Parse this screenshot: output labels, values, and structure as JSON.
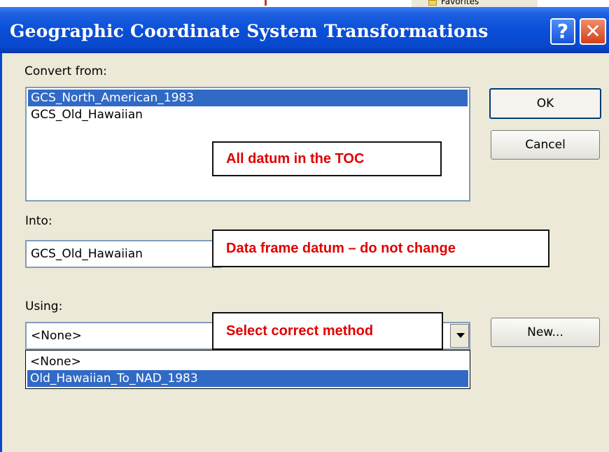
{
  "background_window": {
    "favorites_label": "Favorites"
  },
  "window": {
    "title": "Geographic Coordinate System Transformations",
    "help_glyph": "?",
    "close_glyph": "✕"
  },
  "convert_from": {
    "label": "Convert from:",
    "items": [
      {
        "text": "GCS_North_American_1983",
        "selected": true
      },
      {
        "text": "GCS_Old_Hawaiian",
        "selected": false
      }
    ]
  },
  "into": {
    "label": "Into:",
    "value": "GCS_Old_Hawaiian"
  },
  "using": {
    "label": "Using:",
    "value": "<None>",
    "options": [
      {
        "text": "<None>",
        "selected": false
      },
      {
        "text": "Old_Hawaiian_To_NAD_1983",
        "selected": true
      }
    ]
  },
  "buttons": {
    "ok": "OK",
    "cancel": "Cancel",
    "new": "New..."
  },
  "annotations": {
    "toc": "All datum in the TOC",
    "data_frame": "Data frame datum – do not change",
    "method": "Select correct method"
  },
  "colors": {
    "title_bar": "#0848cc",
    "selection": "#316ac5",
    "annotation_text": "#e00000"
  }
}
